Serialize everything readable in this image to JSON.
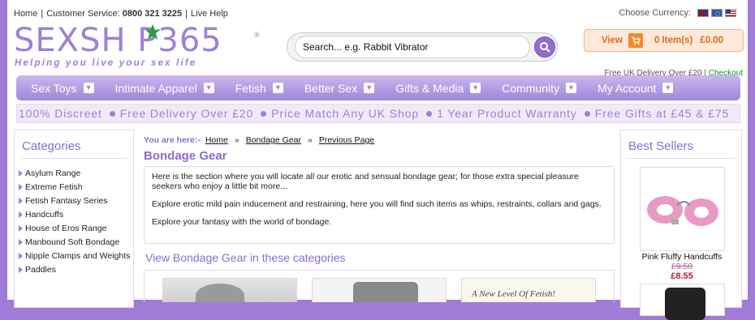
{
  "topbar": {
    "home": "Home",
    "customer_service_label": "Customer Service:",
    "phone": "0800 321 3225",
    "live_help": "Live Help",
    "choose_currency": "Choose Currency:"
  },
  "logo": {
    "text": "SEXSH P365",
    "reg": "®",
    "tagline": "Helping you live your sex life"
  },
  "search": {
    "placeholder": "Search... e.g. Rabbit Vibrator",
    "value": "Search... e.g. Rabbit Vibrator"
  },
  "basket": {
    "view_label": "View",
    "items": "0 Item(s)",
    "total": "£0.00"
  },
  "delivery": {
    "text": "Free UK Delivery Over £20 |",
    "checkout": "Checkout"
  },
  "nav": {
    "items": [
      "Sex Toys",
      "Intimate Apparel",
      "Fetish",
      "Better Sex",
      "Gifts & Media",
      "Community",
      "My Account"
    ]
  },
  "promo": {
    "items": [
      "100% Discreet",
      "Free Delivery Over £20",
      "Price Match Any UK Shop",
      "1 Year Product Warranty",
      "Free Gifts at £45 & £75"
    ]
  },
  "categories": {
    "title": "Categories",
    "items": [
      "Asylum Range",
      "Extreme Fetish",
      "Fetish Fantasy Series",
      "Handcuffs",
      "House of Eros Range",
      "Manbound Soft Bondage",
      "Nipple Clamps and Weights",
      "Paddles"
    ]
  },
  "breadcrumb": {
    "label": "You are here:-",
    "home": "Home",
    "current": "Bondage Gear",
    "previous": "Previous Page"
  },
  "main": {
    "title": "Bondage Gear",
    "intro_1": "Here is the section where you will locate all our erotic and sensual bondage gear; for those extra special pleasure seekers who enjoy a little bit more...",
    "intro_2": "Explore erotic mild pain inducement and restraining, here you will find such items as whips, restraints, collars and gags.",
    "intro_3": "Explore your fantasy with the world of bondage.",
    "sub_title": "View Bondage Gear in these categories",
    "thumb3_text": "A New Level Of Fetish!"
  },
  "bestsellers": {
    "title": "Best Sellers",
    "product_name": "Pink Fluffy Handcuffs",
    "old_price": "£9.50",
    "new_price": "£8.55"
  }
}
